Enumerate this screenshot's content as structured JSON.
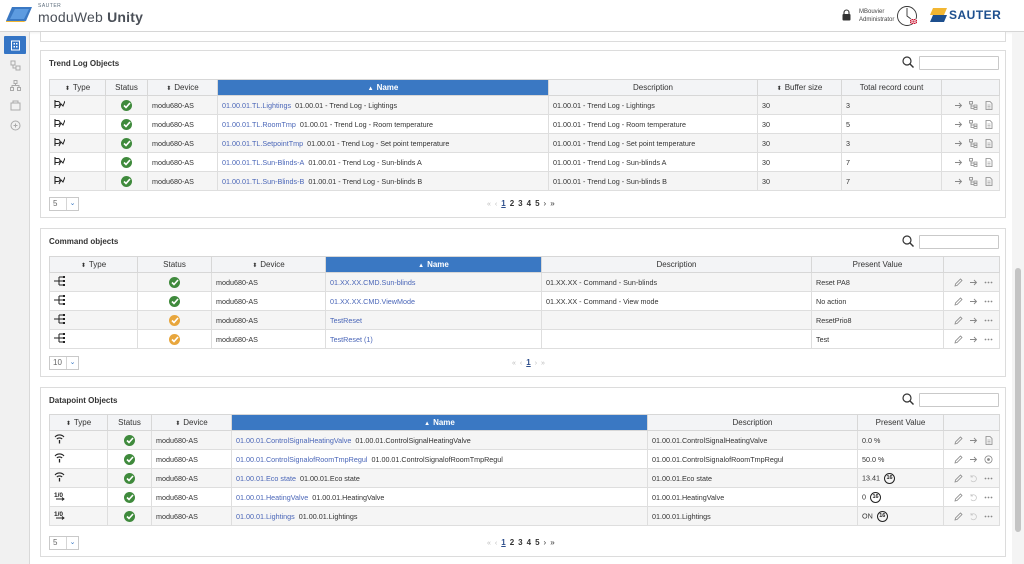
{
  "app": {
    "brand_small": "SAUTER",
    "brand_name": "moduWeb",
    "brand_suffix": "Unity",
    "user_name": "MBouvier",
    "user_role": "Administrator",
    "company": "SAUTER",
    "accent": "#3a78c3"
  },
  "trend": {
    "title": "Trend Log Objects",
    "headers": {
      "type": "Type",
      "status": "Status",
      "device": "Device",
      "name": "Name",
      "description": "Description",
      "buffer": "Buffer size",
      "total": "Total record count"
    },
    "rows": [
      {
        "device": "modu680-AS",
        "name_link": "01.00.01.TL.Lightings",
        "name_text": "01.00.01 - Trend Log - Lightings",
        "description": "01.00.01 - Trend Log - Lightings",
        "buffer": "30",
        "total": "3"
      },
      {
        "device": "modu680-AS",
        "name_link": "01.00.01.TL.RoomTmp",
        "name_text": "01.00.01 - Trend Log - Room temperature",
        "description": "01.00.01 - Trend Log - Room temperature",
        "buffer": "30",
        "total": "5"
      },
      {
        "device": "modu680-AS",
        "name_link": "01.00.01.TL.SetpointTmp",
        "name_text": "01.00.01 - Trend Log - Set point temperature",
        "description": "01.00.01 - Trend Log - Set point temperature",
        "buffer": "30",
        "total": "3"
      },
      {
        "device": "modu680-AS",
        "name_link": "01.00.01.TL.Sun-Blinds-A",
        "name_text": "01.00.01 - Trend Log - Sun-blinds A",
        "description": "01.00.01 - Trend Log - Sun-blinds A",
        "buffer": "30",
        "total": "7"
      },
      {
        "device": "modu680-AS",
        "name_link": "01.00.01.TL.Sun-Blinds-B",
        "name_text": "01.00.01 - Trend Log - Sun-blinds B",
        "description": "01.00.01 - Trend Log - Sun-blinds B",
        "buffer": "30",
        "total": "7"
      }
    ],
    "page_size": "5",
    "pages": [
      "1",
      "2",
      "3",
      "4",
      "5"
    ]
  },
  "command": {
    "title": "Command objects",
    "headers": {
      "type": "Type",
      "status": "Status",
      "device": "Device",
      "name": "Name",
      "description": "Description",
      "present": "Present Value"
    },
    "rows": [
      {
        "status": "ok",
        "device": "modu680-AS",
        "name_link": "01.XX.XX.CMD.Sun-blinds",
        "description": "01.XX.XX - Command - Sun-blinds",
        "present": "Reset PA8"
      },
      {
        "status": "ok",
        "device": "modu680-AS",
        "name_link": "01.XX.XX.CMD.ViewMode",
        "description": "01.XX.XX - Command - View mode",
        "present": "No action"
      },
      {
        "status": "warn",
        "device": "modu680-AS",
        "name_link": "TestReset",
        "description": "",
        "present": "ResetPrio8"
      },
      {
        "status": "warn",
        "device": "modu680-AS",
        "name_link": "TestReset (1)",
        "description": "",
        "present": "Test"
      }
    ],
    "page_size": "10",
    "pages": [
      "1"
    ]
  },
  "datapoint": {
    "title": "Datapoint Objects",
    "headers": {
      "type": "Type",
      "status": "Status",
      "device": "Device",
      "name": "Name",
      "description": "Description",
      "present": "Present Value"
    },
    "rows": [
      {
        "type": "analog",
        "device": "modu680-AS",
        "name_link": "01.00.01.ControlSignalHeatingValve",
        "name_text": "01.00.01.ControlSignalHeatingValve",
        "description": "01.00.01.ControlSignalHeatingValve",
        "present": "0.0 %",
        "badge": ""
      },
      {
        "type": "analog",
        "device": "modu680-AS",
        "name_link": "01.00.01.ControlSignalofRoomTmpRegul",
        "name_text": "01.00.01.ControlSignalofRoomTmpRegul",
        "description": "01.00.01.ControlSignalofRoomTmpRegul",
        "present": "50.0 %",
        "badge": ""
      },
      {
        "type": "analog",
        "device": "modu680-AS",
        "name_link": "01.00.01.Eco state",
        "name_text": "01.00.01.Eco state",
        "description": "01.00.01.Eco state",
        "present": "13.41",
        "badge": "16"
      },
      {
        "type": "binary",
        "device": "modu680-AS",
        "name_link": "01.00.01.HeatingValve",
        "name_text": "01.00.01.HeatingValve",
        "description": "01.00.01.HeatingValve",
        "present": "0",
        "badge": "16"
      },
      {
        "type": "binary",
        "device": "modu680-AS",
        "name_link": "01.00.01.Lightings",
        "name_text": "01.00.01.Lightings",
        "description": "01.00.01.Lightings",
        "present": "ON",
        "badge": "16"
      }
    ],
    "page_size": "5",
    "pages": [
      "1",
      "2",
      "3",
      "4",
      "5"
    ]
  }
}
